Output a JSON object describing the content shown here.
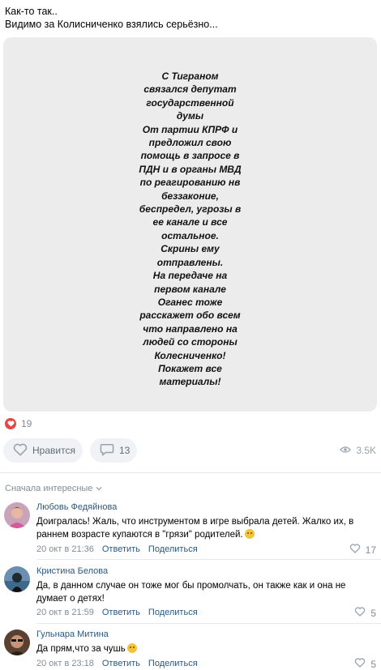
{
  "post": {
    "text_line1": "Как-то так..",
    "text_line2": "Видимо за Колисниченко взялись серьёзно...",
    "story_lines": [
      "С Тиграном",
      "связался депутат",
      "государственной",
      "думы",
      "От партии КПРФ и",
      "предложил свою",
      "помощь в запросе в",
      "ПДН и в органы МВД",
      "по реагированию нв",
      "беззаконие,",
      "беспредел, угрозы в",
      "ее канале и все",
      "остальное.",
      "Скрины ему",
      "отправлены.",
      "На передаче на",
      "первом канале",
      "Оганес тоже",
      "расскажет обо всем",
      "что направлено на",
      "людей со стороны",
      "Колесниченко!",
      "Покажет все",
      "материалы!"
    ],
    "reactions_count": "19",
    "like_label": "Нравится",
    "comments_count": "13",
    "views": "3.5K"
  },
  "comments_section": {
    "sort_label": "Сначала интересные"
  },
  "comments": [
    {
      "author": "Любовь Федяйнова",
      "text": "Доигралась! Жаль, что инструментом в игре выбрала детей. Жалко их, в раннем возрасте купаются в \"грязи\" родителей.",
      "date": "20 окт в 21:36",
      "reply": "Ответить",
      "share": "Поделиться",
      "likes": "17"
    },
    {
      "author": "Кристина Белова",
      "text": "Да, в данном случае он тоже мог бы промолчать, он также как и она не думает о детях!",
      "date": "20 окт в 21:59",
      "reply": "Ответить",
      "share": "Поделиться",
      "likes": "5"
    },
    {
      "author": "Гульнара Митина",
      "text": "Да прям,что за чушь",
      "date": "20 окт в 23:18",
      "reply": "Ответить",
      "share": "Поделиться",
      "likes": "5"
    }
  ],
  "colors": {
    "accent": "#2a5885",
    "like_red": "#e64646",
    "card_bg": "#ececec"
  },
  "icons": [
    "heart-icon",
    "comment-icon",
    "eye-icon",
    "chevron-down-icon",
    "emoji-icon"
  ]
}
